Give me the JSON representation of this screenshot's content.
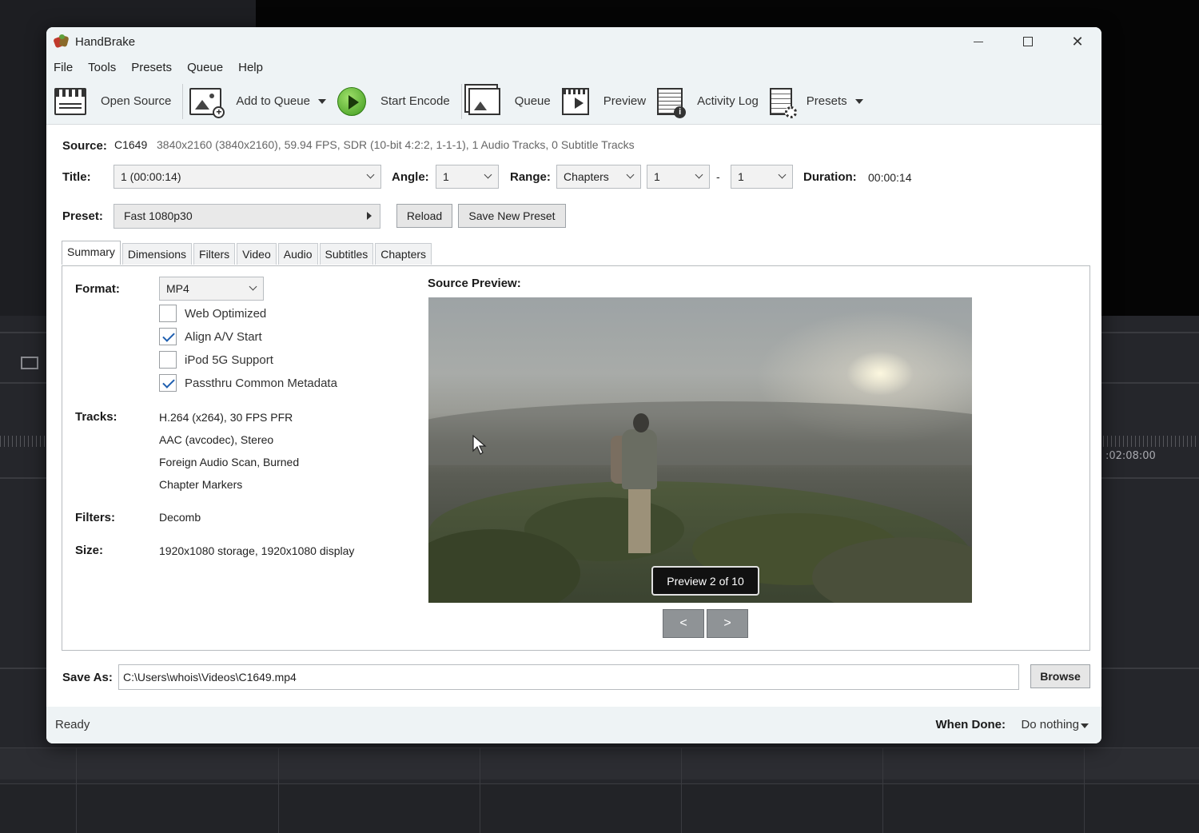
{
  "background": {
    "timecode": ":02:08:00"
  },
  "window": {
    "title": "HandBrake"
  },
  "menu": [
    "File",
    "Tools",
    "Presets",
    "Queue",
    "Help"
  ],
  "toolbar": {
    "open_source": "Open Source",
    "add_to_queue": "Add to Queue",
    "start_encode": "Start Encode",
    "queue": "Queue",
    "preview": "Preview",
    "activity_log": "Activity Log",
    "presets": "Presets"
  },
  "source": {
    "label": "Source:",
    "name": "C1649",
    "details": "3840x2160 (3840x2160), 59.94 FPS, SDR (10-bit 4:2:2, 1-1-1), 1 Audio Tracks, 0 Subtitle Tracks"
  },
  "title_row": {
    "title_label": "Title:",
    "title_value": "1  (00:00:14)",
    "angle_label": "Angle:",
    "angle_value": "1",
    "range_label": "Range:",
    "range_type": "Chapters",
    "range_start": "1",
    "range_sep": "-",
    "range_end": "1",
    "duration_label": "Duration:",
    "duration_value": "00:00:14"
  },
  "preset_row": {
    "label": "Preset:",
    "value": "Fast 1080p30",
    "reload": "Reload",
    "save_new": "Save New Preset"
  },
  "tabs": [
    "Summary",
    "Dimensions",
    "Filters",
    "Video",
    "Audio",
    "Subtitles",
    "Chapters"
  ],
  "summary": {
    "format_label": "Format:",
    "format_value": "MP4",
    "checkboxes": [
      {
        "label": "Web Optimized",
        "checked": false
      },
      {
        "label": "Align A/V Start",
        "checked": true
      },
      {
        "label": "iPod 5G Support",
        "checked": false
      },
      {
        "label": "Passthru Common Metadata",
        "checked": true
      }
    ],
    "tracks_label": "Tracks:",
    "tracks": [
      "H.264 (x264), 30 FPS PFR",
      "AAC (avcodec), Stereo",
      "Foreign Audio Scan, Burned",
      "Chapter Markers"
    ],
    "filters_label": "Filters:",
    "filters_value": "Decomb",
    "size_label": "Size:",
    "size_value": "1920x1080 storage, 1920x1080 display",
    "source_preview_label": "Source Preview:",
    "preview_badge": "Preview 2 of 10",
    "prev_button": "<",
    "next_button": ">"
  },
  "save_as": {
    "label": "Save As:",
    "path": "C:\\Users\\whois\\Videos\\C1649.mp4",
    "browse": "Browse"
  },
  "status": {
    "text": "Ready",
    "when_done_label": "When Done:",
    "when_done_value": "Do nothing"
  }
}
